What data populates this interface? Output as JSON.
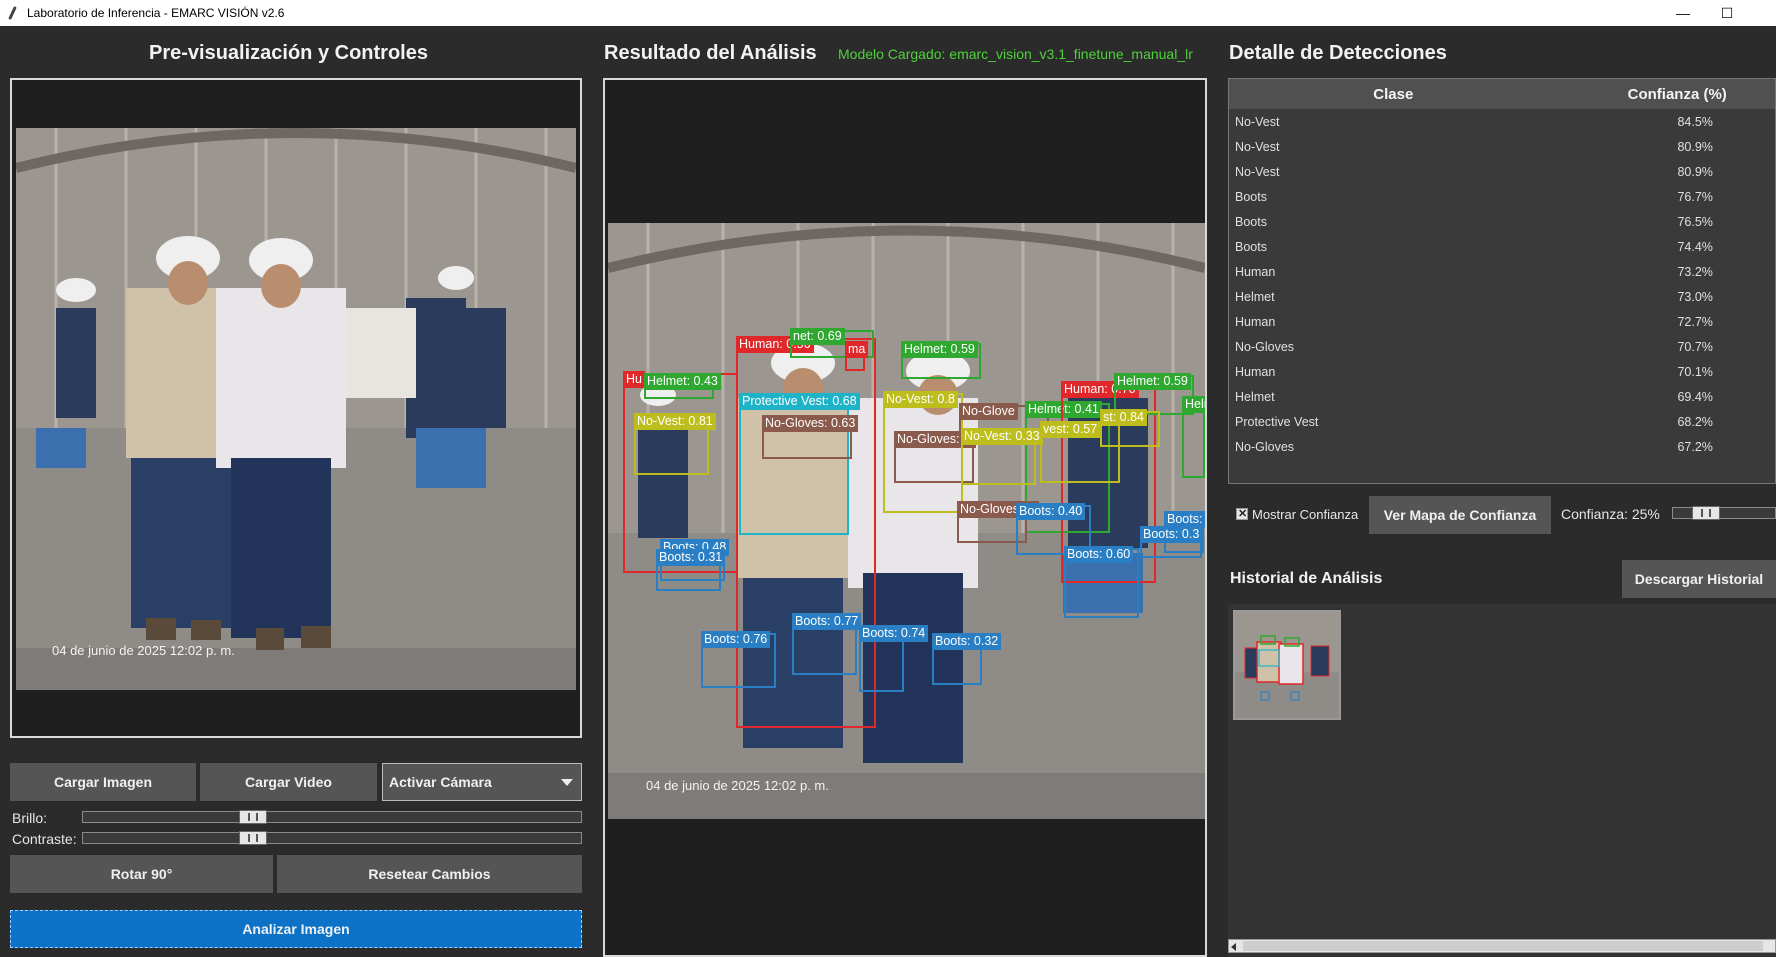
{
  "window": {
    "title": "Laboratorio de Inferencia - EMARC VISIÓN v2.6",
    "min_glyph": "—",
    "max_glyph": "☐"
  },
  "left": {
    "heading": "Pre-visualización y Controles",
    "timestamp": "04 de junio de 2025 12:02 p. m.",
    "buttons": {
      "load_image": "Cargar Imagen",
      "load_video": "Cargar Video",
      "camera": "Activar Cámara",
      "rotate": "Rotar 90°",
      "reset": "Resetear Cambios",
      "analyze": "Analizar Imagen"
    },
    "brightness_label": "Brillo:",
    "contrast_label": "Contraste:",
    "brightness_value": 0.33,
    "contrast_value": 0.33
  },
  "center": {
    "heading": "Resultado del Análisis",
    "model_label": "Modelo Cargado: emarc_vision_v3.1_finetune_manual_lr",
    "timestamp": "04 de junio de 2025 12:02 p. m.",
    "detections": [
      {
        "label": "Human: 0.56",
        "color": "#e0272a"
      },
      {
        "label": "net: 0.69",
        "color": "#2fa82f"
      },
      {
        "label": "ma",
        "color": "#e0272a"
      },
      {
        "label": "Helmet: 0.59",
        "color": "#2fa82f"
      },
      {
        "label": "Hu",
        "color": "#e0272a"
      },
      {
        "label": "Helmet: 0.43",
        "color": "#2fa82f"
      },
      {
        "label": "Protective Vest: 0.68",
        "color": "#1fb3c8"
      },
      {
        "label": "No-Vest: 0.81",
        "color": "#bdbd1e"
      },
      {
        "label": "No-Gloves: 0.63",
        "color": "#8a5a4c"
      },
      {
        "label": "No-Vest: 0.8",
        "color": "#bdbd1e"
      },
      {
        "label": "No-Gloves: 0.",
        "color": "#8a5a4c"
      },
      {
        "label": "No-Glove",
        "color": "#8a5a4c"
      },
      {
        "label": "Helmet: 0.41",
        "color": "#2fa82f"
      },
      {
        "label": "No-Vest: 0.33",
        "color": "#bdbd1e"
      },
      {
        "label": "Human: 0.70",
        "color": "#e0272a"
      },
      {
        "label": "Helmet: 0.59",
        "color": "#2fa82f"
      },
      {
        "label": "Heln",
        "color": "#2fa82f"
      },
      {
        "label": "st: 0.84",
        "color": "#bdbd1e"
      },
      {
        "label": "vest: 0.57",
        "color": "#bdbd1e"
      },
      {
        "label": "No-Gloves: 0.",
        "color": "#8a5a4c"
      },
      {
        "label": "Boots: 0.40",
        "color": "#2a7fc4"
      },
      {
        "label": "Boots:",
        "color": "#2a7fc4"
      },
      {
        "label": "Boots: 0.3",
        "color": "#2a7fc4"
      },
      {
        "label": "Boots: 0.60",
        "color": "#2a7fc4"
      },
      {
        "label": "Boots: 0.48",
        "color": "#2a7fc4"
      },
      {
        "label": "Boots: 0.31",
        "color": "#2a7fc4"
      },
      {
        "label": "Boots: 0.77",
        "color": "#2a7fc4"
      },
      {
        "label": "Boots: 0.76",
        "color": "#2a7fc4"
      },
      {
        "label": "Boots: 0.74",
        "color": "#2a7fc4"
      },
      {
        "label": "Boots: 0.32",
        "color": "#2a7fc4"
      }
    ]
  },
  "right": {
    "heading": "Detalle de Detecciones",
    "table_headers": {
      "clase": "Clase",
      "confianza": "Confianza (%)"
    },
    "rows": [
      {
        "clase": "No-Vest",
        "conf": "84.5%"
      },
      {
        "clase": "No-Vest",
        "conf": "80.9%"
      },
      {
        "clase": "No-Vest",
        "conf": "80.9%"
      },
      {
        "clase": "Boots",
        "conf": "76.7%"
      },
      {
        "clase": "Boots",
        "conf": "76.5%"
      },
      {
        "clase": "Boots",
        "conf": "74.4%"
      },
      {
        "clase": "Human",
        "conf": "73.2%"
      },
      {
        "clase": "Helmet",
        "conf": "73.0%"
      },
      {
        "clase": "Human",
        "conf": "72.7%"
      },
      {
        "clase": "No-Gloves",
        "conf": "70.7%"
      },
      {
        "clase": "Human",
        "conf": "70.1%"
      },
      {
        "clase": "Helmet",
        "conf": "69.4%"
      },
      {
        "clase": "Protective Vest",
        "conf": "68.2%"
      },
      {
        "clase": "No-Gloves",
        "conf": "67.2%"
      }
    ],
    "show_confidence_label": "Mostrar Confianza",
    "show_confidence_checked": true,
    "confidence_map_button": "Ver Mapa de Confianza",
    "confidence_threshold_label": "Confianza: 25%",
    "confidence_threshold_value": 0.25,
    "history_heading": "Historial de Análisis",
    "download_history_button": "Descargar Historial"
  }
}
